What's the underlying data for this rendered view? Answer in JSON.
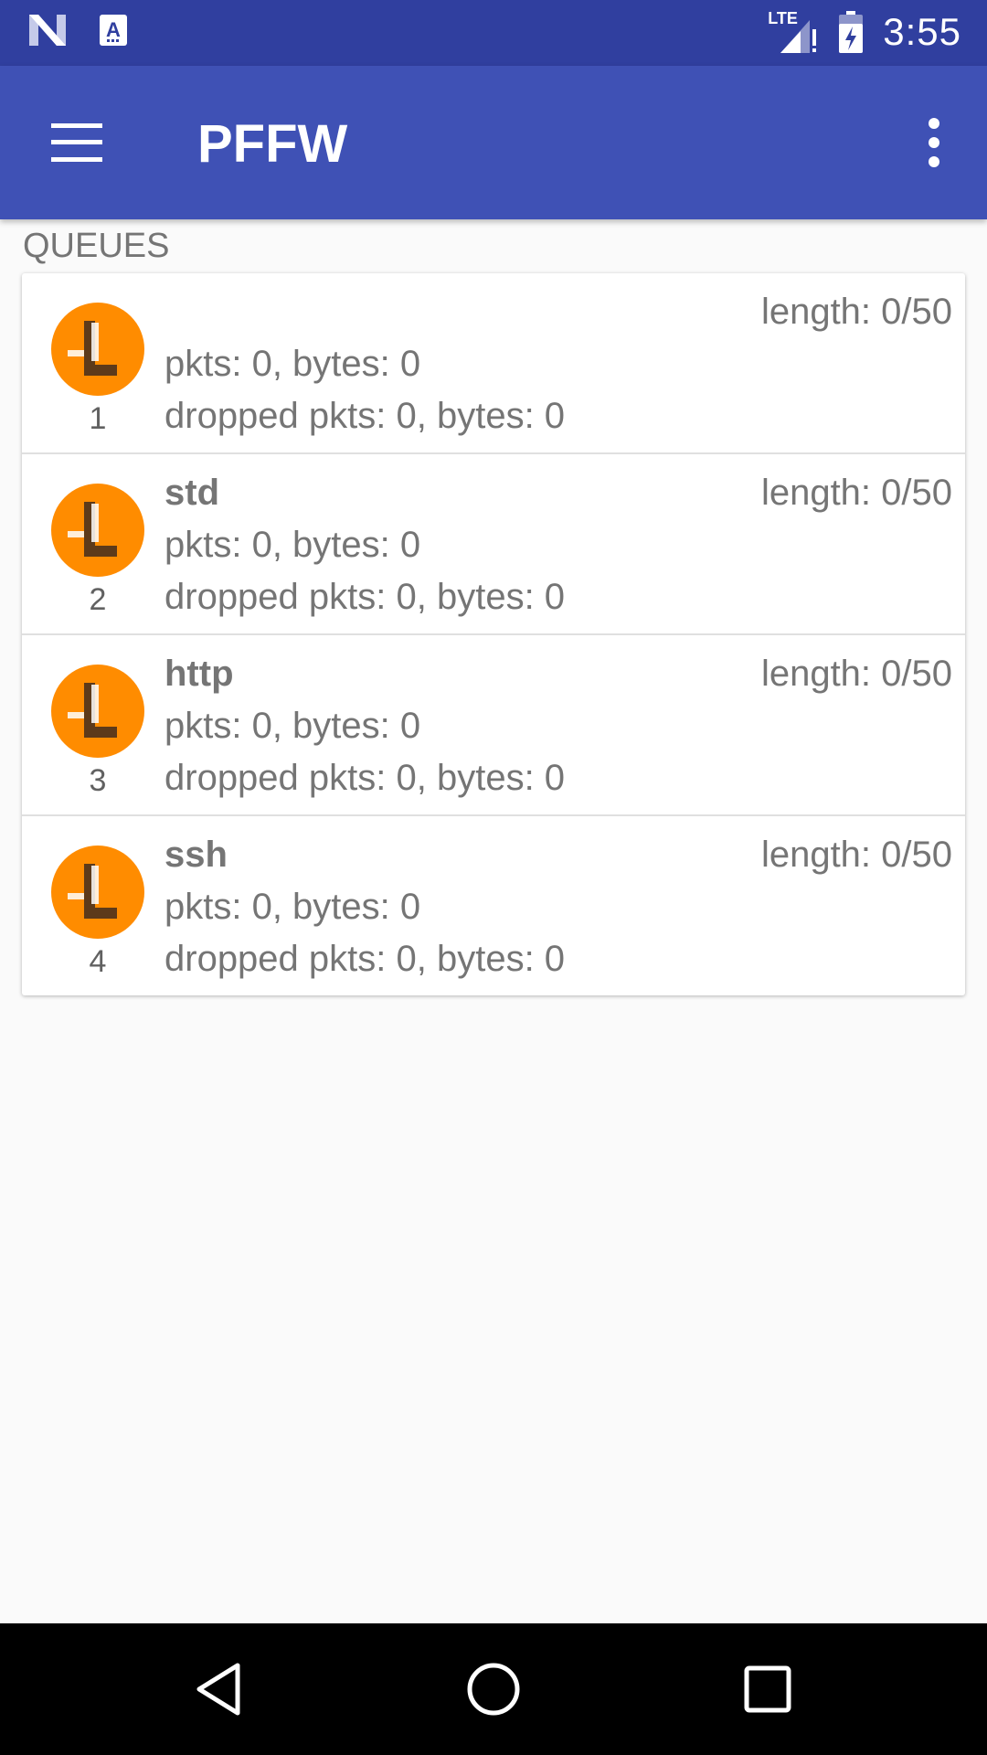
{
  "status_bar": {
    "time": "3:55",
    "network": "LTE",
    "icons": [
      "n-logo-icon",
      "a-notification-icon",
      "lte-signal-icon",
      "battery-icon"
    ]
  },
  "app_bar": {
    "title": "PFFW",
    "nav_icon": "menu-icon",
    "action_icon": "overflow-menu-icon"
  },
  "section": {
    "label": "QUEUES"
  },
  "queues": [
    {
      "number": "1",
      "name": "",
      "length": "length: 0/50",
      "pkts": "pkts: 0, bytes: 0",
      "dropped": "dropped pkts: 0, bytes: 0"
    },
    {
      "number": "2",
      "name": "std",
      "length": "length: 0/50",
      "pkts": "pkts: 0, bytes: 0",
      "dropped": "dropped pkts: 0, bytes: 0"
    },
    {
      "number": "3",
      "name": "http",
      "length": "length: 0/50",
      "pkts": "pkts: 0, bytes: 0",
      "dropped": "dropped pkts: 0, bytes: 0"
    },
    {
      "number": "4",
      "name": "ssh",
      "length": "length: 0/50",
      "pkts": "pkts: 0, bytes: 0",
      "dropped": "dropped pkts: 0, bytes: 0"
    }
  ],
  "colors": {
    "status_bar": "#303f9f",
    "app_bar": "#3f51b5",
    "queue_icon": "#ff8c00"
  },
  "nav_bar": {
    "buttons": [
      "back-icon",
      "home-icon",
      "recents-icon"
    ]
  }
}
